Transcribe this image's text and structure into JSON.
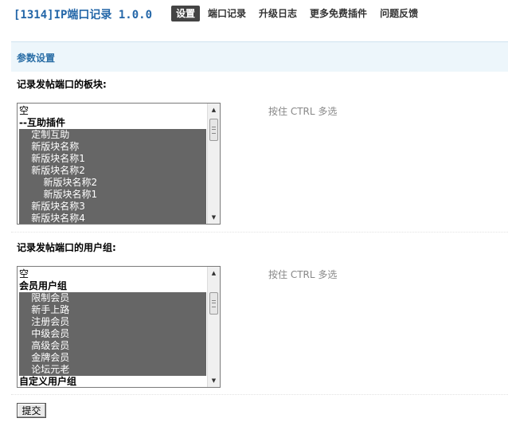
{
  "app": {
    "title": "[1314]IP端口记录 1.0.0"
  },
  "nav": {
    "items": [
      {
        "label": "设置",
        "active": true
      },
      {
        "label": "端口记录",
        "active": false
      },
      {
        "label": "升级日志",
        "active": false
      },
      {
        "label": "更多免费插件",
        "active": false
      },
      {
        "label": "问题反馈",
        "active": false
      }
    ]
  },
  "section": {
    "title": "参数设置"
  },
  "forum_field": {
    "label": "记录发帖端口的板块:",
    "hint": "按住 CTRL 多选",
    "options": [
      {
        "label": "空",
        "selected": false,
        "group": false
      },
      {
        "label": "--互助插件",
        "selected": false,
        "group": true
      },
      {
        "label": "    定制互助",
        "selected": true,
        "group": false
      },
      {
        "label": "    新版块名称",
        "selected": true,
        "group": false
      },
      {
        "label": "    新版块名称1",
        "selected": true,
        "group": false
      },
      {
        "label": "    新版块名称2",
        "selected": true,
        "group": false
      },
      {
        "label": "        新版块名称2",
        "selected": true,
        "group": false
      },
      {
        "label": "        新版块名称1",
        "selected": true,
        "group": false
      },
      {
        "label": "    新版块名称3",
        "selected": true,
        "group": false
      },
      {
        "label": "    新版块名称4",
        "selected": true,
        "group": false
      }
    ]
  },
  "usergroup_field": {
    "label": "记录发帖端口的用户组:",
    "hint": "按住 CTRL 多选",
    "options": [
      {
        "label": "空",
        "selected": false,
        "group": false
      },
      {
        "label": "会员用户组",
        "selected": false,
        "group": true
      },
      {
        "label": "    限制会员",
        "selected": true,
        "group": false
      },
      {
        "label": "    新手上路",
        "selected": true,
        "group": false
      },
      {
        "label": "    注册会员",
        "selected": true,
        "group": false
      },
      {
        "label": "    中级会员",
        "selected": true,
        "group": false
      },
      {
        "label": "    高级会员",
        "selected": true,
        "group": false
      },
      {
        "label": "    金牌会员",
        "selected": true,
        "group": false
      },
      {
        "label": "    论坛元老",
        "selected": true,
        "group": false
      },
      {
        "label": "自定义用户组",
        "selected": false,
        "group": true
      }
    ]
  },
  "form": {
    "submit_label": "提交"
  }
}
